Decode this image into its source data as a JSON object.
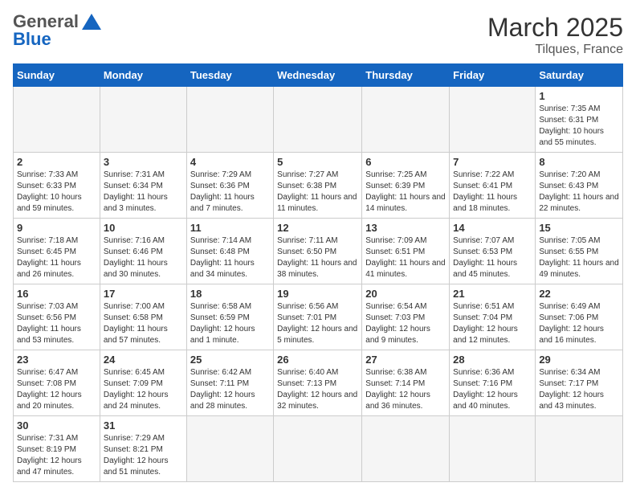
{
  "header": {
    "logo_general": "General",
    "logo_blue": "Blue",
    "month": "March 2025",
    "location": "Tilques, France"
  },
  "days_of_week": [
    "Sunday",
    "Monday",
    "Tuesday",
    "Wednesday",
    "Thursday",
    "Friday",
    "Saturday"
  ],
  "weeks": [
    [
      {
        "day": "",
        "info": ""
      },
      {
        "day": "",
        "info": ""
      },
      {
        "day": "",
        "info": ""
      },
      {
        "day": "",
        "info": ""
      },
      {
        "day": "",
        "info": ""
      },
      {
        "day": "",
        "info": ""
      },
      {
        "day": "1",
        "info": "Sunrise: 7:35 AM\nSunset: 6:31 PM\nDaylight: 10 hours and 55 minutes."
      }
    ],
    [
      {
        "day": "2",
        "info": "Sunrise: 7:33 AM\nSunset: 6:33 PM\nDaylight: 10 hours and 59 minutes."
      },
      {
        "day": "3",
        "info": "Sunrise: 7:31 AM\nSunset: 6:34 PM\nDaylight: 11 hours and 3 minutes."
      },
      {
        "day": "4",
        "info": "Sunrise: 7:29 AM\nSunset: 6:36 PM\nDaylight: 11 hours and 7 minutes."
      },
      {
        "day": "5",
        "info": "Sunrise: 7:27 AM\nSunset: 6:38 PM\nDaylight: 11 hours and 11 minutes."
      },
      {
        "day": "6",
        "info": "Sunrise: 7:25 AM\nSunset: 6:39 PM\nDaylight: 11 hours and 14 minutes."
      },
      {
        "day": "7",
        "info": "Sunrise: 7:22 AM\nSunset: 6:41 PM\nDaylight: 11 hours and 18 minutes."
      },
      {
        "day": "8",
        "info": "Sunrise: 7:20 AM\nSunset: 6:43 PM\nDaylight: 11 hours and 22 minutes."
      }
    ],
    [
      {
        "day": "9",
        "info": "Sunrise: 7:18 AM\nSunset: 6:45 PM\nDaylight: 11 hours and 26 minutes."
      },
      {
        "day": "10",
        "info": "Sunrise: 7:16 AM\nSunset: 6:46 PM\nDaylight: 11 hours and 30 minutes."
      },
      {
        "day": "11",
        "info": "Sunrise: 7:14 AM\nSunset: 6:48 PM\nDaylight: 11 hours and 34 minutes."
      },
      {
        "day": "12",
        "info": "Sunrise: 7:11 AM\nSunset: 6:50 PM\nDaylight: 11 hours and 38 minutes."
      },
      {
        "day": "13",
        "info": "Sunrise: 7:09 AM\nSunset: 6:51 PM\nDaylight: 11 hours and 41 minutes."
      },
      {
        "day": "14",
        "info": "Sunrise: 7:07 AM\nSunset: 6:53 PM\nDaylight: 11 hours and 45 minutes."
      },
      {
        "day": "15",
        "info": "Sunrise: 7:05 AM\nSunset: 6:55 PM\nDaylight: 11 hours and 49 minutes."
      }
    ],
    [
      {
        "day": "16",
        "info": "Sunrise: 7:03 AM\nSunset: 6:56 PM\nDaylight: 11 hours and 53 minutes."
      },
      {
        "day": "17",
        "info": "Sunrise: 7:00 AM\nSunset: 6:58 PM\nDaylight: 11 hours and 57 minutes."
      },
      {
        "day": "18",
        "info": "Sunrise: 6:58 AM\nSunset: 6:59 PM\nDaylight: 12 hours and 1 minute."
      },
      {
        "day": "19",
        "info": "Sunrise: 6:56 AM\nSunset: 7:01 PM\nDaylight: 12 hours and 5 minutes."
      },
      {
        "day": "20",
        "info": "Sunrise: 6:54 AM\nSunset: 7:03 PM\nDaylight: 12 hours and 9 minutes."
      },
      {
        "day": "21",
        "info": "Sunrise: 6:51 AM\nSunset: 7:04 PM\nDaylight: 12 hours and 12 minutes."
      },
      {
        "day": "22",
        "info": "Sunrise: 6:49 AM\nSunset: 7:06 PM\nDaylight: 12 hours and 16 minutes."
      }
    ],
    [
      {
        "day": "23",
        "info": "Sunrise: 6:47 AM\nSunset: 7:08 PM\nDaylight: 12 hours and 20 minutes."
      },
      {
        "day": "24",
        "info": "Sunrise: 6:45 AM\nSunset: 7:09 PM\nDaylight: 12 hours and 24 minutes."
      },
      {
        "day": "25",
        "info": "Sunrise: 6:42 AM\nSunset: 7:11 PM\nDaylight: 12 hours and 28 minutes."
      },
      {
        "day": "26",
        "info": "Sunrise: 6:40 AM\nSunset: 7:13 PM\nDaylight: 12 hours and 32 minutes."
      },
      {
        "day": "27",
        "info": "Sunrise: 6:38 AM\nSunset: 7:14 PM\nDaylight: 12 hours and 36 minutes."
      },
      {
        "day": "28",
        "info": "Sunrise: 6:36 AM\nSunset: 7:16 PM\nDaylight: 12 hours and 40 minutes."
      },
      {
        "day": "29",
        "info": "Sunrise: 6:34 AM\nSunset: 7:17 PM\nDaylight: 12 hours and 43 minutes."
      }
    ],
    [
      {
        "day": "30",
        "info": "Sunrise: 7:31 AM\nSunset: 8:19 PM\nDaylight: 12 hours and 47 minutes."
      },
      {
        "day": "31",
        "info": "Sunrise: 7:29 AM\nSunset: 8:21 PM\nDaylight: 12 hours and 51 minutes."
      },
      {
        "day": "",
        "info": ""
      },
      {
        "day": "",
        "info": ""
      },
      {
        "day": "",
        "info": ""
      },
      {
        "day": "",
        "info": ""
      },
      {
        "day": "",
        "info": ""
      }
    ]
  ]
}
